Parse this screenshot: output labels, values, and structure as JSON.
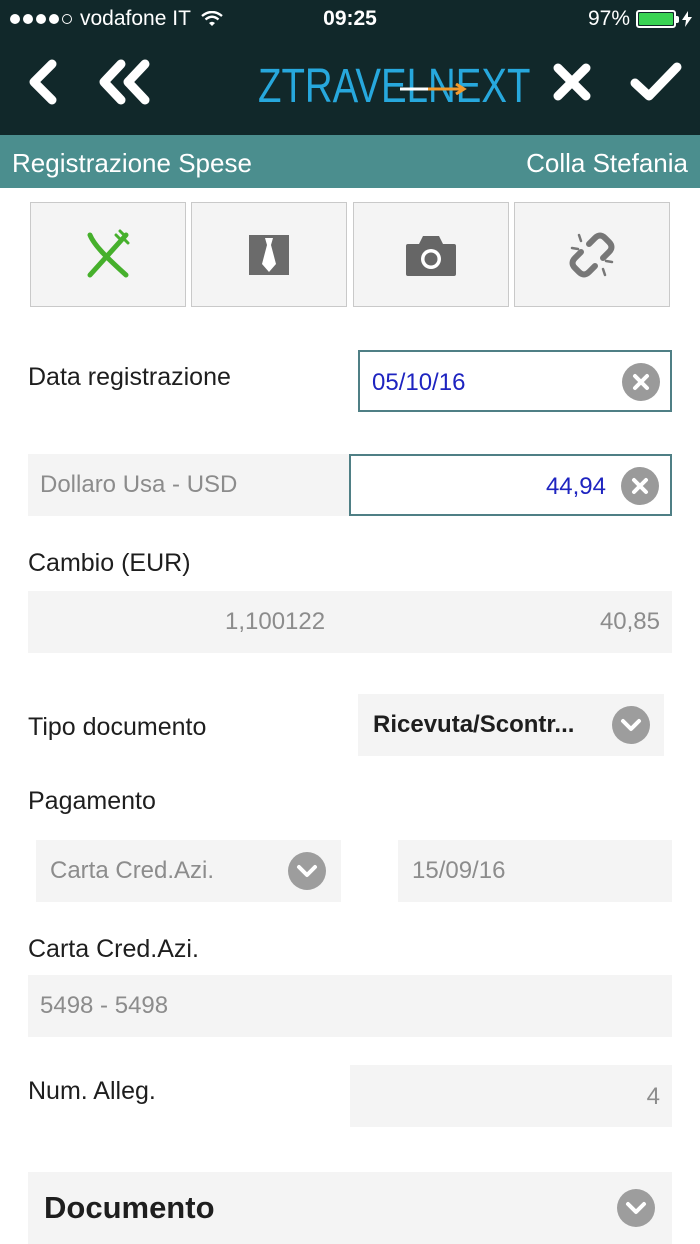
{
  "status_bar": {
    "carrier": "vodafone IT",
    "time": "09:25",
    "battery": "97%",
    "battery_level": 0.97,
    "signal_bars_filled": 4,
    "signal_bars_total": 5
  },
  "nav": {
    "logo_part1": "ZTRAVEL",
    "logo_part2": "NEXT",
    "back_icon": "chevron-left-icon",
    "back_all_icon": "double-chevron-left-icon",
    "close_icon": "close-icon",
    "confirm_icon": "checkmark-icon"
  },
  "header": {
    "title": "Registrazione Spese",
    "user": "Colla Stefania"
  },
  "categories": [
    {
      "icon": "fork-knife-icon",
      "selected": true
    },
    {
      "icon": "tie-icon",
      "selected": false
    },
    {
      "icon": "camera-icon",
      "selected": false
    },
    {
      "icon": "link-broken-icon",
      "selected": false
    }
  ],
  "form": {
    "data_registrazione": {
      "label": "Data registrazione",
      "value": "05/10/16"
    },
    "valuta": {
      "currency": "Dollaro Usa - USD",
      "amount": "44,94"
    },
    "cambio": {
      "label": "Cambio (EUR)",
      "rate": "1,100122",
      "converted": "40,85"
    },
    "tipo_documento": {
      "label": "Tipo documento",
      "value": "Ricevuta/Scontr..."
    },
    "pagamento": {
      "label": "Pagamento",
      "method": "Carta Cred.Azi.",
      "date": "15/09/16"
    },
    "carta": {
      "label": "Carta Cred.Azi.",
      "value": "5498 - 5498"
    },
    "num_alleg": {
      "label": "Num. Alleg.",
      "value": "4"
    },
    "documento": {
      "label": "Documento"
    }
  },
  "colors": {
    "top_bar": "#11282a",
    "title_bar": "#4b8e8e",
    "logo_blue": "#27a8dd",
    "logo_arrow": "#f29a2e",
    "input_text": "#1e24c0",
    "category_green": "#46b02c"
  }
}
